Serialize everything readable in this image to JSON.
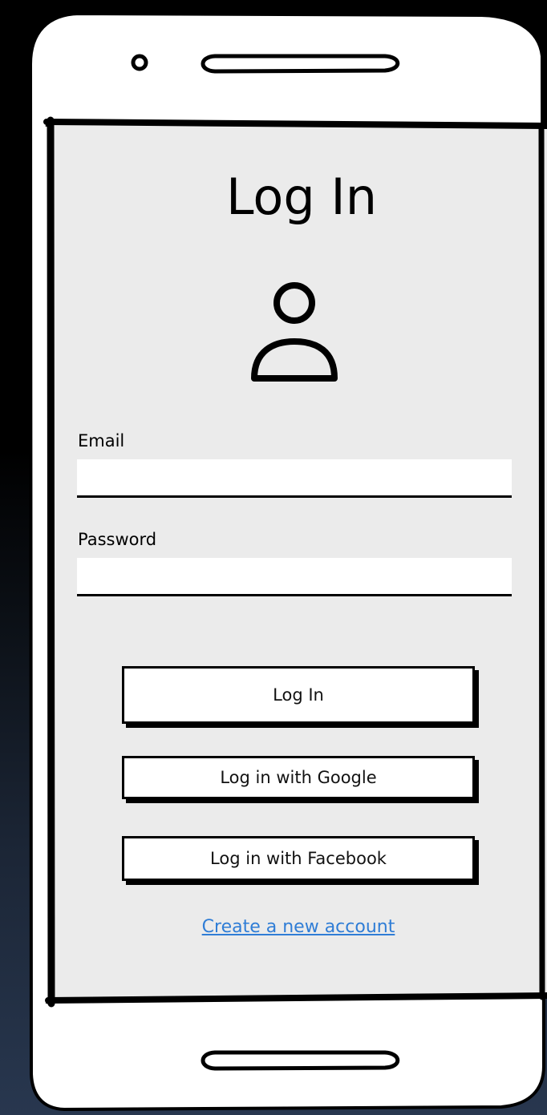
{
  "screen": {
    "title": "Log In"
  },
  "form": {
    "email_label": "Email",
    "email_value": "",
    "password_label": "Password",
    "password_value": ""
  },
  "buttons": {
    "login_label": "Log In",
    "google_label": "Log in with Google",
    "facebook_label": "Log in with Facebook"
  },
  "links": {
    "create_account": "Create a new account"
  },
  "icons": {
    "camera": "camera-icon",
    "speaker": "speaker-icon",
    "home_bar": "home-bar-icon",
    "user": "user-icon"
  },
  "colors": {
    "screen_background": "#ebebeb",
    "phone_body": "#ffffff",
    "outline": "#000000",
    "link": "#2f7dd6"
  }
}
